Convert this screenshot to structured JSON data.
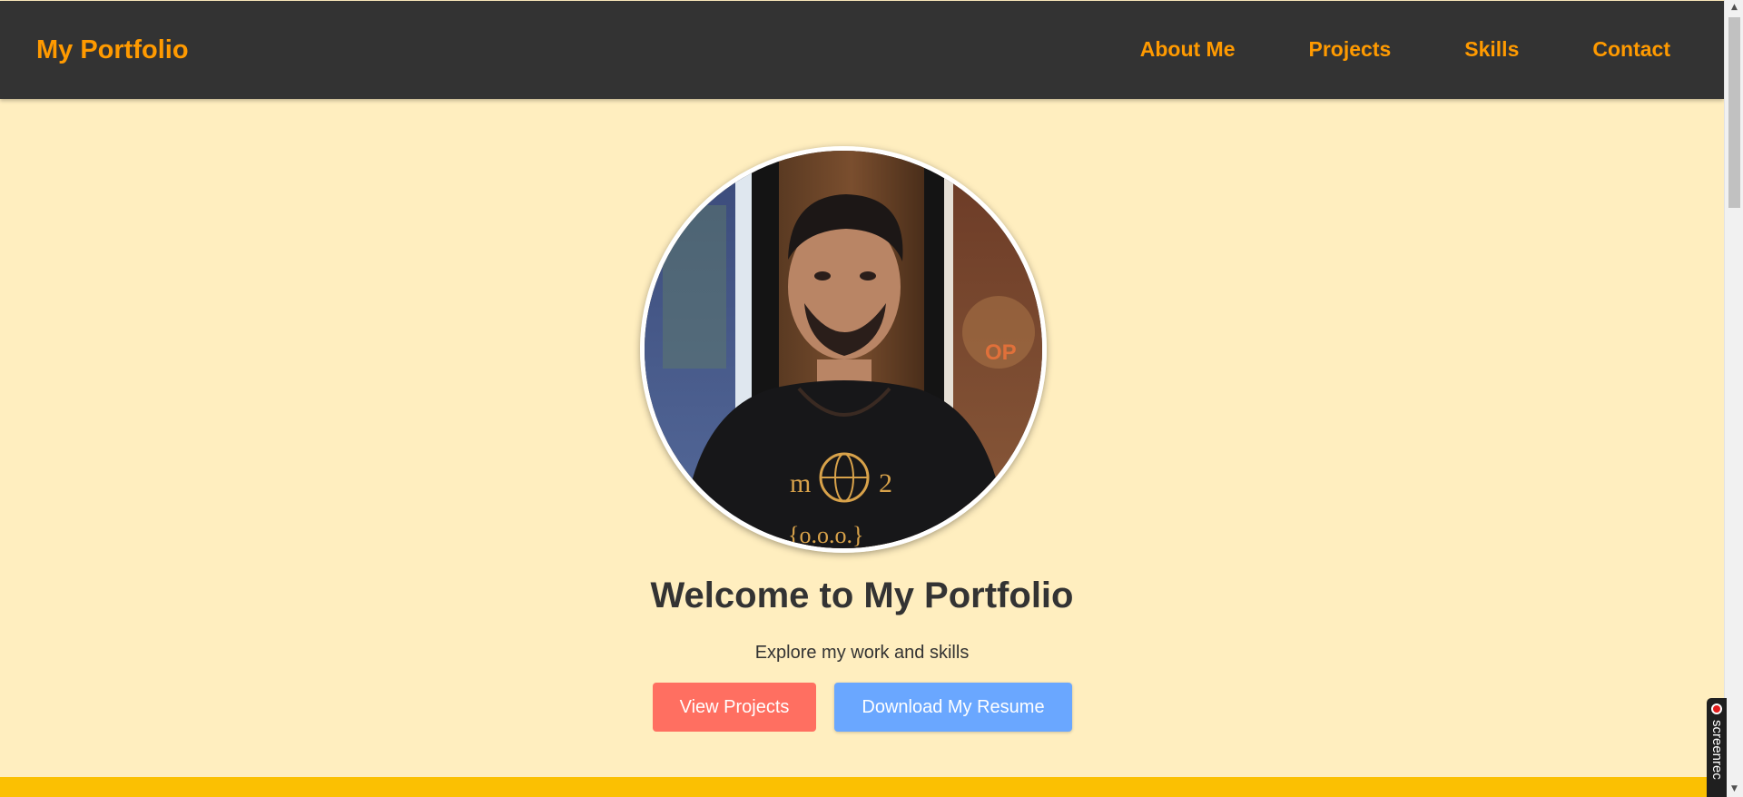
{
  "navbar": {
    "brand": "My Portfolio",
    "links": [
      {
        "label": "About Me"
      },
      {
        "label": "Projects"
      },
      {
        "label": "Skills"
      },
      {
        "label": "Contact"
      }
    ],
    "accent_color": "#ff9a00",
    "background_color": "#333333"
  },
  "hero": {
    "title": "Welcome to My Portfolio",
    "subtitle": "Explore my work and skills",
    "buttons": {
      "view_projects": "View Projects",
      "download_resume": "Download My Resume"
    },
    "button_colors": {
      "view_projects": "#ff6f61",
      "download_resume": "#6aa7ff"
    },
    "background_color": "#ffeebf",
    "avatar": "profile-photo"
  },
  "recorder": {
    "label": "screenrec"
  },
  "footer_band_color": "#fbc002"
}
